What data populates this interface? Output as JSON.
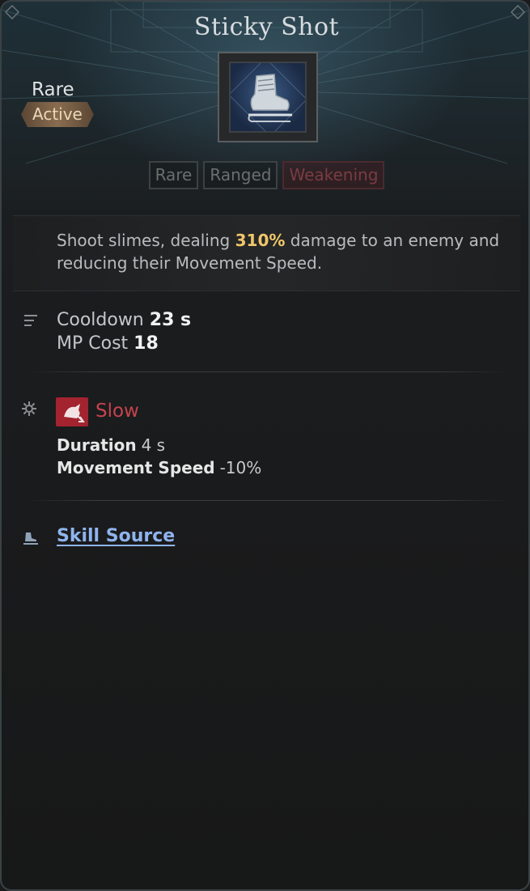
{
  "header": {
    "title": "Sticky Shot",
    "rarity": "Rare",
    "skill_type": "Active",
    "skill_icon": "skate-boot-icon"
  },
  "tags": [
    {
      "label": "Rare"
    },
    {
      "label": "Ranged"
    },
    {
      "label": "Weakening"
    }
  ],
  "description": {
    "before": "Shoot slimes, dealing ",
    "highlight": "310%",
    "after": " damage to an enemy and reducing their Movement Speed."
  },
  "stats": {
    "cooldown_label": "Cooldown",
    "cooldown_value": "23 s",
    "mp_label": "MP Cost",
    "mp_value": "18"
  },
  "effect": {
    "name": "Slow",
    "icon": "slow-debuff-icon",
    "duration_label": "Duration",
    "duration_value": "4 s",
    "speed_label": "Movement Speed",
    "speed_value": "-10%"
  },
  "source": {
    "label": "Skill Source"
  },
  "colors": {
    "highlight": "#f0c76a",
    "debuff": "#c6434e",
    "link": "#8fb4ee",
    "badge": "#8a6d50"
  }
}
